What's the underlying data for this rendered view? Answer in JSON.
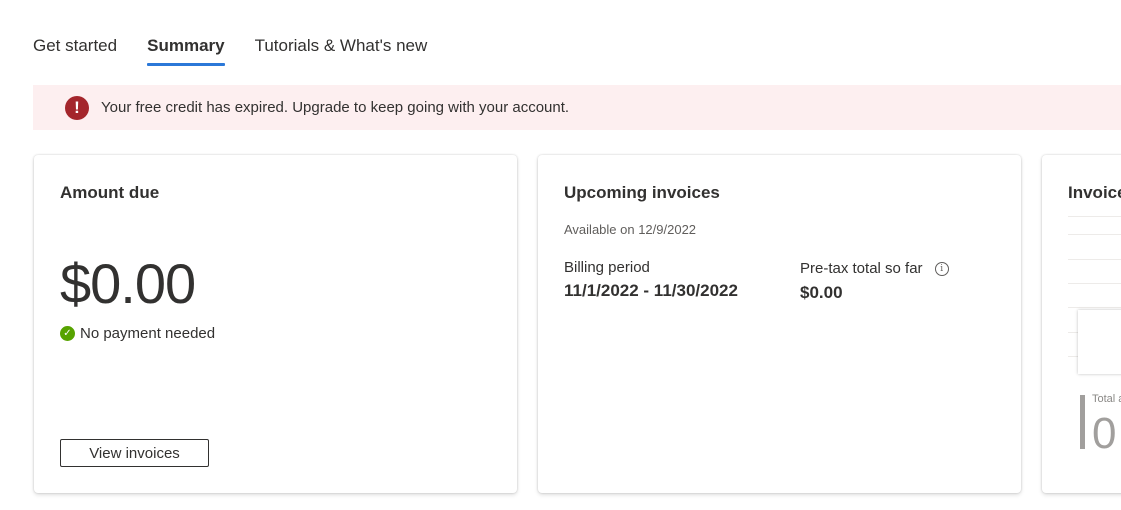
{
  "tabs": [
    {
      "label": "Get started",
      "active": false
    },
    {
      "label": "Summary",
      "active": true
    },
    {
      "label": "Tutorials & What's new",
      "active": false
    }
  ],
  "alert": {
    "icon": "error-exclamation-icon",
    "message": "Your free credit has expired. Upgrade to keep going with your account.",
    "color": "#a4262c"
  },
  "amount_due": {
    "title": "Amount due",
    "amount": "$0.00",
    "status": "No payment needed",
    "status_icon": "check-circle-icon",
    "button": "View invoices"
  },
  "upcoming_invoices": {
    "title": "Upcoming invoices",
    "available": "Available on 12/9/2022",
    "billing_period_label": "Billing period",
    "billing_period_value": "11/1/2022 - 11/30/2022",
    "pretax_label": "Pre-tax total so far",
    "pretax_value": "$0.00",
    "info_icon": "info-icon"
  },
  "invoice_card": {
    "title": "Invoice",
    "total_label": "Total a",
    "total_value": "0"
  },
  "colors": {
    "accent": "#2b78d8",
    "error": "#a4262c",
    "success": "#57a300",
    "alert_bg": "#fdeff0"
  }
}
